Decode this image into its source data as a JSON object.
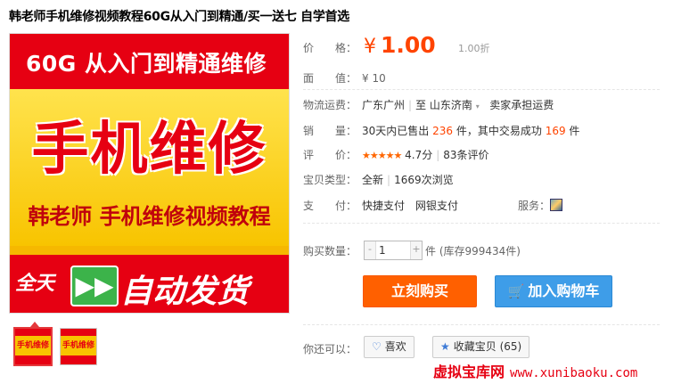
{
  "title": "韩老师手机维修视频教程60G从入门到精通/买一送七 自学首选",
  "main_image": {
    "top_text": "60G 从入门到精通维修",
    "big_text": "手机维修",
    "sub_text": "韩老师 手机维修视频教程",
    "bottom_left": "全天",
    "play_glyph": "▶▶",
    "bottom_right": "自动发货",
    "colors": {
      "red": "#e60012",
      "yellow": "#f8c400",
      "green": "#3cb34a"
    }
  },
  "thumbnails": [
    {
      "label": "手机维修",
      "selected": true
    },
    {
      "label": "手机维修",
      "selected": false
    }
  ],
  "price": {
    "label": "价　　格：",
    "currency": "¥",
    "value": "1.00",
    "discount": "1.00折"
  },
  "face_value": {
    "label": "面　　值：",
    "value": "¥ 10"
  },
  "shipping": {
    "label": "物流运费：",
    "from": "广东广州",
    "to_prefix": "至",
    "to": "山东济南",
    "note": "卖家承担运费"
  },
  "sales": {
    "label": "销　　量：",
    "prefix": "30天内已售出",
    "sold": "236",
    "mid": "件，其中交易成功",
    "success": "169",
    "suffix": "件"
  },
  "rating": {
    "label": "评　　价：",
    "stars": "★★★★★",
    "score": "4.7分",
    "reviews": "83条评价"
  },
  "item_type": {
    "label": "宝贝类型：",
    "condition": "全新",
    "views": "1669次浏览"
  },
  "payment": {
    "label": "支　　付：",
    "methods": "快捷支付　网银支付",
    "service_label": "服务："
  },
  "quantity": {
    "label": "购买数量：",
    "minus": "-",
    "value": "1",
    "plus": "+",
    "stock": "件 (库存999434件)"
  },
  "buttons": {
    "buy": "立刻购买",
    "cart": "加入购物车",
    "cart_icon": "🛒"
  },
  "share": {
    "label": "你还可以：",
    "like": "喜欢",
    "like_icon": "♡",
    "favorite": "收藏宝贝 (65)",
    "favorite_icon": "★"
  },
  "watermark": {
    "text": "虚拟宝库网",
    "url": "www.xunibaoku.com"
  }
}
